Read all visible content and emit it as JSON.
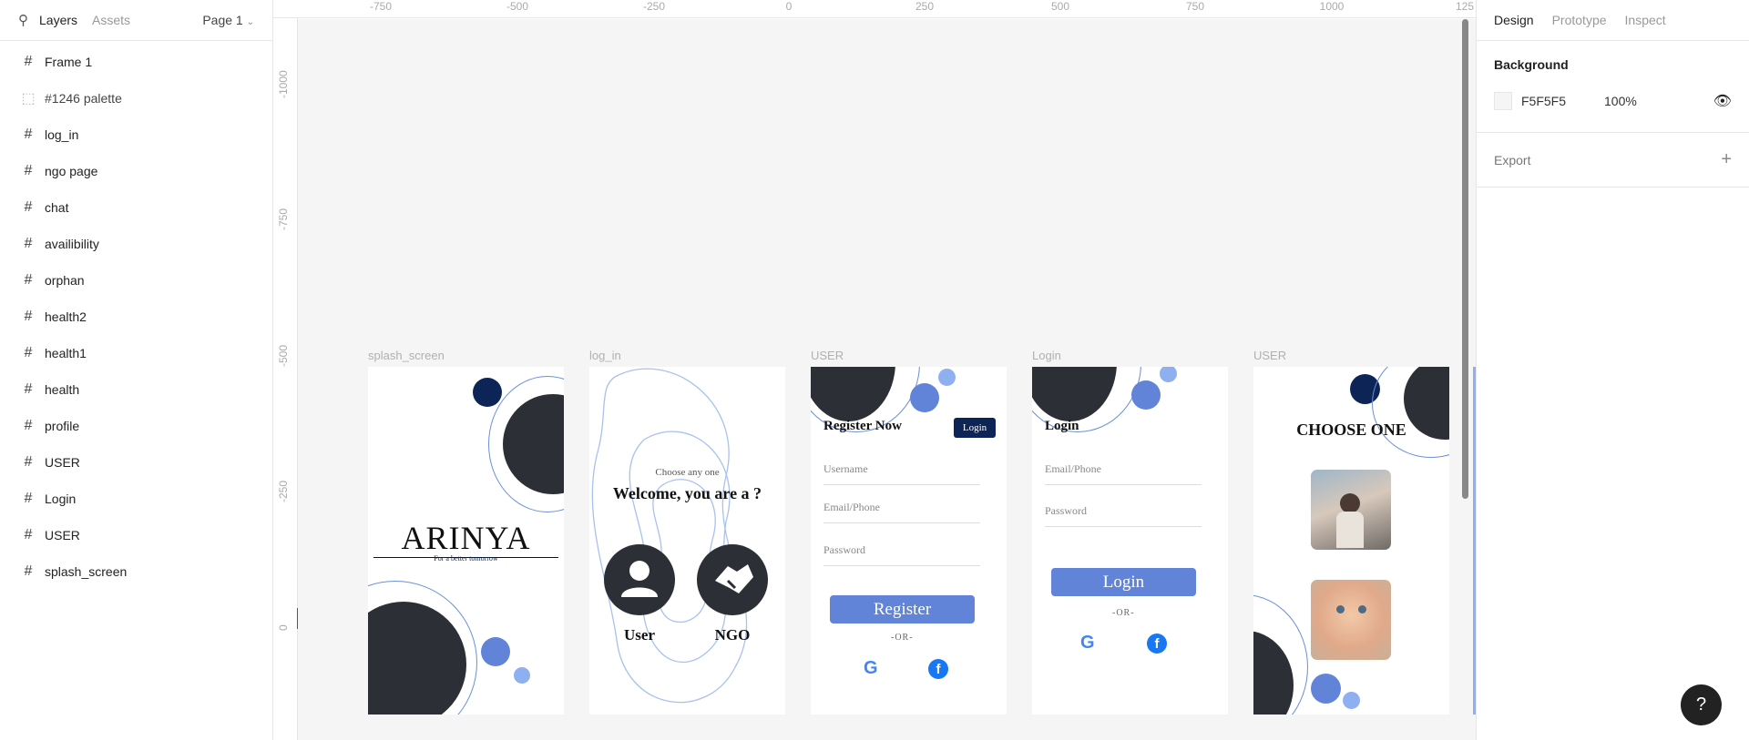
{
  "left_panel": {
    "tabs": [
      "Layers",
      "Assets"
    ],
    "page_select": "Page 1",
    "layers": [
      {
        "name": "Frame 1",
        "type": "frame"
      },
      {
        "name": "#1246 palette",
        "type": "group"
      },
      {
        "name": "log_in",
        "type": "frame"
      },
      {
        "name": "ngo page",
        "type": "frame"
      },
      {
        "name": "chat",
        "type": "frame"
      },
      {
        "name": "availibility",
        "type": "frame"
      },
      {
        "name": "orphan",
        "type": "frame"
      },
      {
        "name": "health2",
        "type": "frame"
      },
      {
        "name": "health1",
        "type": "frame"
      },
      {
        "name": "health",
        "type": "frame"
      },
      {
        "name": "profile",
        "type": "frame"
      },
      {
        "name": "USER",
        "type": "frame"
      },
      {
        "name": "Login",
        "type": "frame"
      },
      {
        "name": "USER",
        "type": "frame"
      },
      {
        "name": "splash_screen",
        "type": "frame"
      }
    ]
  },
  "ruler": {
    "horizontal": [
      "-750",
      "-500",
      "-250",
      "0",
      "250",
      "500",
      "750",
      "1000",
      "125"
    ],
    "vertical": [
      "-1000",
      "-750",
      "-500",
      "-250",
      "0"
    ]
  },
  "frames": {
    "splash": {
      "label": "splash_screen",
      "title": "ARINYA",
      "tagline": "For a better tomorrow"
    },
    "log_in": {
      "label": "log_in",
      "subtitle": "Choose any one",
      "heading": "Welcome, you are a ?",
      "option_user": "User",
      "option_ngo": "NGO"
    },
    "register": {
      "label": "USER",
      "title": "Register Now",
      "login_btn": "Login",
      "username": "Username",
      "email": "Email/Phone",
      "password": "Password",
      "button": "Register",
      "or": "-OR-"
    },
    "login": {
      "label": "Login",
      "title": "Login",
      "email": "Email/Phone",
      "password": "Password",
      "button": "Login",
      "or": "-OR-"
    },
    "choose": {
      "label": "USER",
      "title": "CHOOSE ONE"
    }
  },
  "right_panel": {
    "tabs": [
      "Design",
      "Prototype",
      "Inspect"
    ],
    "background_title": "Background",
    "background_hex": "F5F5F5",
    "background_opacity": "100%",
    "export_title": "Export"
  },
  "colors": {
    "navy": "#0d2456",
    "dark": "#2c2f36",
    "blue": "#6183d8",
    "light_blue": "#8fb0f0",
    "canvas": "#f5f5f5"
  }
}
